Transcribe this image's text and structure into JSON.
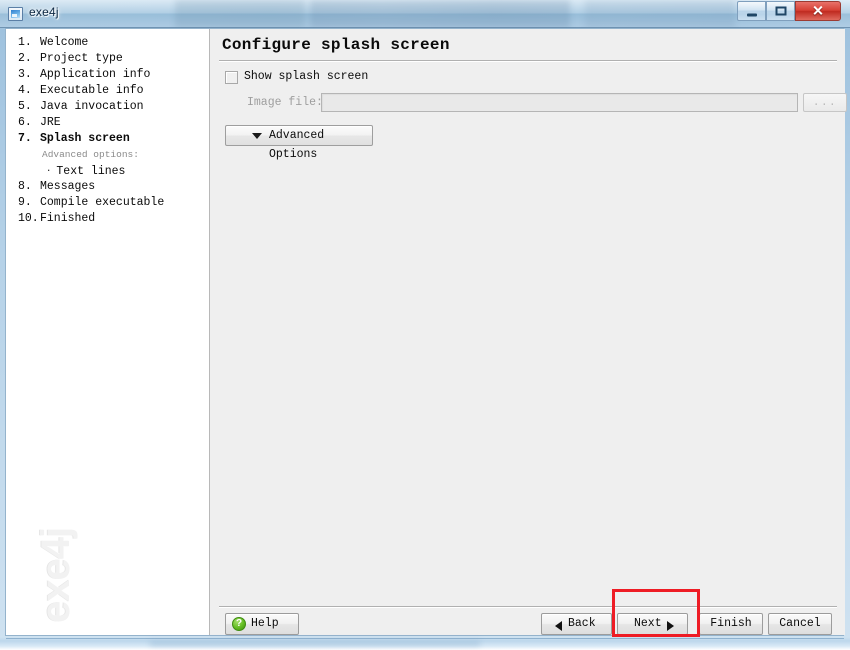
{
  "window": {
    "title": "exe4j",
    "app_icon": "exe4j-app-icon",
    "controls": {
      "minimize": "minimize-icon",
      "maximize": "maximize-icon",
      "close": "✕"
    }
  },
  "sidebar": {
    "watermark": "exe4j",
    "items": [
      {
        "num": "1.",
        "label": "Welcome",
        "current": false
      },
      {
        "num": "2.",
        "label": "Project type",
        "current": false
      },
      {
        "num": "3.",
        "label": "Application info",
        "current": false
      },
      {
        "num": "4.",
        "label": "Executable info",
        "current": false
      },
      {
        "num": "5.",
        "label": "Java invocation",
        "current": false
      },
      {
        "num": "6.",
        "label": "JRE",
        "current": false
      },
      {
        "num": "7.",
        "label": "Splash screen",
        "current": true
      },
      {
        "num": "8.",
        "label": "Messages",
        "current": false
      },
      {
        "num": "9.",
        "label": "Compile executable",
        "current": false
      },
      {
        "num": "10.",
        "label": "Finished",
        "current": false
      }
    ],
    "sub_header": "Advanced options:",
    "sub_items": [
      {
        "bullet": "·",
        "label": "Text lines"
      }
    ]
  },
  "content": {
    "page_title": "Configure splash screen",
    "show_splash": {
      "label": "Show splash screen",
      "checked": false
    },
    "image_file": {
      "label": "Image file:",
      "value": "",
      "placeholder": "",
      "browse_label": "...",
      "enabled": false
    },
    "advanced_options": {
      "label": "Advanced Options",
      "chevron": "chevron-down-icon"
    }
  },
  "footer": {
    "help_label": "Help",
    "back_label": "Back",
    "next_label": "Next",
    "finish_label": "Finish",
    "cancel_label": "Cancel"
  },
  "annotation": {
    "color": "#ee1c25",
    "target": "next-button"
  }
}
